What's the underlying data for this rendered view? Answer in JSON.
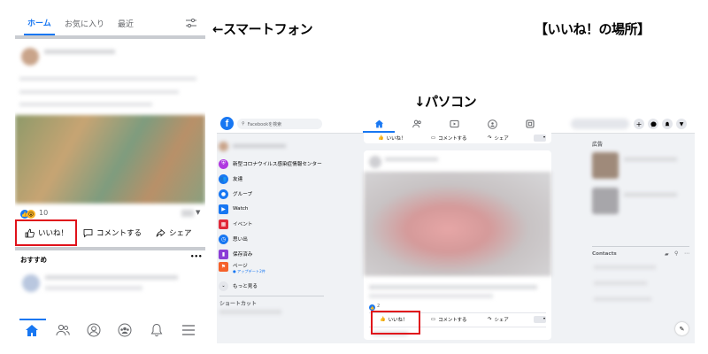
{
  "labels": {
    "smartphone": "←スマートフォン",
    "pc": "↓パソコン",
    "location": "【いいね！の場所】"
  },
  "phone": {
    "tabs": [
      {
        "label": "ホーム",
        "active": true
      },
      {
        "label": "お気に入り",
        "active": false
      },
      {
        "label": "最近",
        "active": false
      }
    ],
    "reaction_count": "10",
    "actions": {
      "like": "いいね！",
      "comment": "コメントする",
      "share": "シェア"
    },
    "section_title": "おすすめ",
    "section_more": "•••"
  },
  "pc": {
    "search_placeholder": "Facebookを検索",
    "logo": "f",
    "sidebar": [
      {
        "label": "新型コロナウイルス感染症情報センター",
        "icon": "shield-icon",
        "color": "#b038e0"
      },
      {
        "label": "友達",
        "icon": "friends-icon",
        "color": "#1877f2"
      },
      {
        "label": "グループ",
        "icon": "groups-icon",
        "color": "#1877f2"
      },
      {
        "label": "Watch",
        "icon": "watch-icon",
        "color": "#1877f2"
      },
      {
        "label": "イベント",
        "icon": "calendar-icon",
        "color": "#e02a3a"
      },
      {
        "label": "思い出",
        "icon": "memories-icon",
        "color": "#1877f2"
      },
      {
        "label": "保存済み",
        "icon": "bookmark-icon",
        "color": "#8b3dd6"
      },
      {
        "label": "ページ",
        "icon": "flag-icon",
        "color": "#f5612a"
      },
      {
        "label": "もっと見る",
        "icon": "chevron-down-icon",
        "color": "#e4e6eb"
      }
    ],
    "pages_sub": "● アップデート2件",
    "shortcuts_title": "ショートカット",
    "actions": {
      "like": "いいね！",
      "comment": "コメントする",
      "share": "シェア"
    },
    "reaction_count": "2",
    "right": {
      "ads_title": "広告",
      "contacts_title": "Contacts"
    }
  },
  "colors": {
    "accent": "#1877f2",
    "highlight": "#e0121b"
  }
}
